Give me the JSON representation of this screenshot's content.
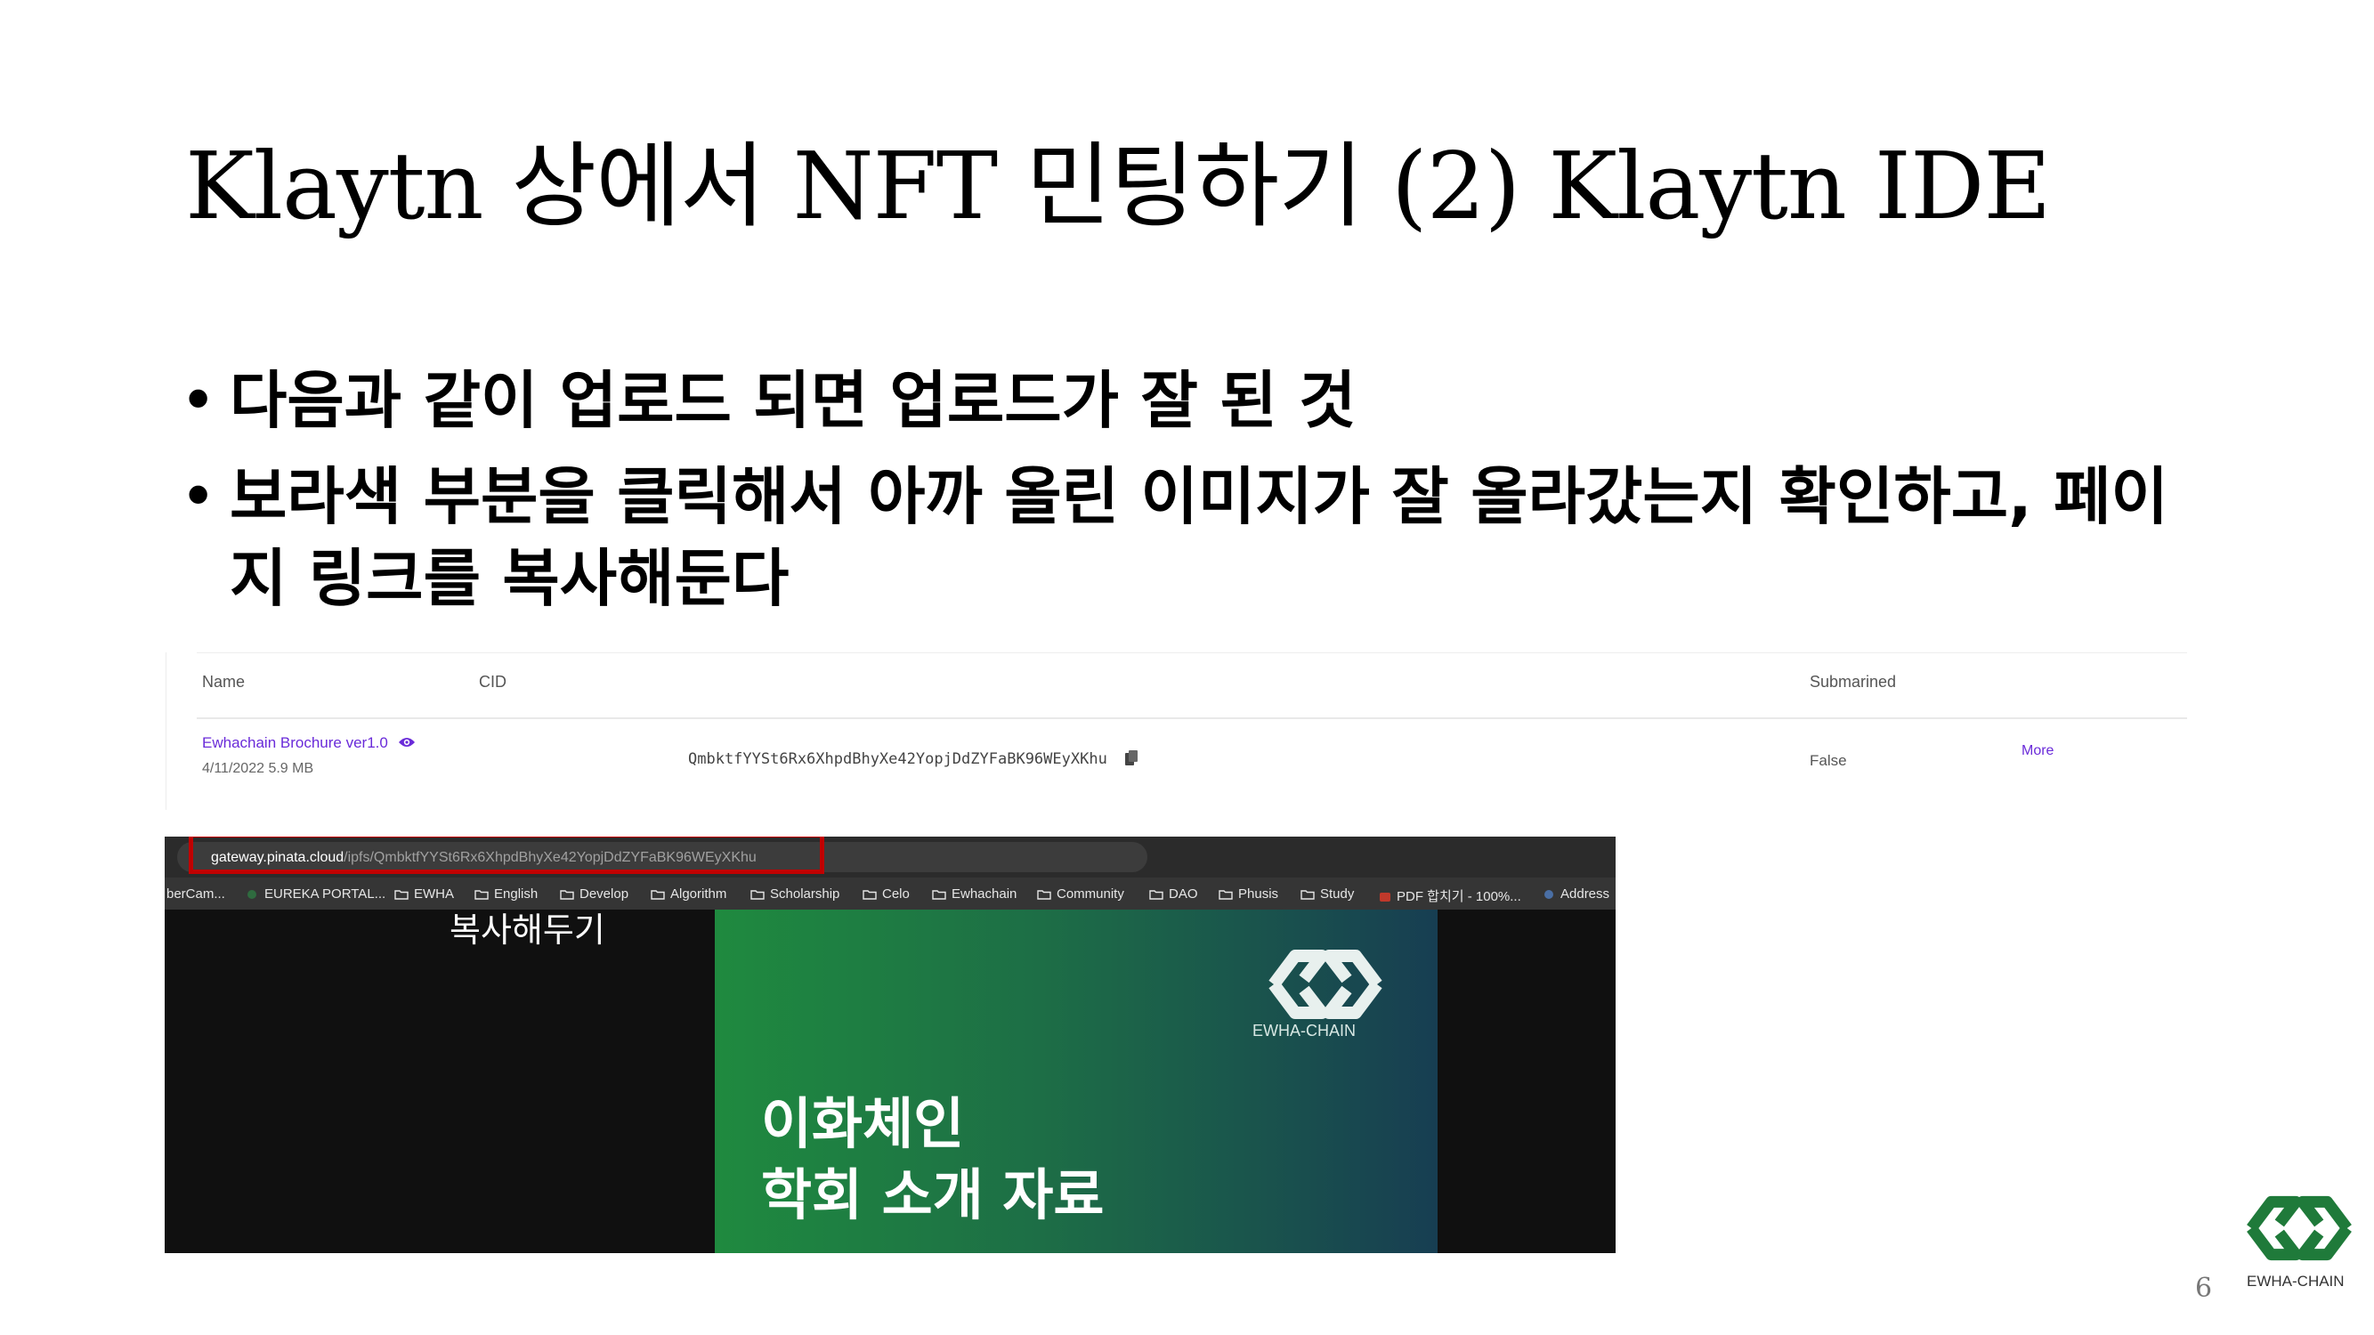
{
  "slide": {
    "title": "Klaytn 상에서 NFT 민팅하기 (2) Klaytn IDE",
    "bullets": [
      "다음과 같이 업로드 되면 업로드가 잘 된 것",
      "보라색 부분을 클릭해서 아까 올린 이미지가 잘 올라갔는지 확인하고, 페이지 링크를 복사해둔다"
    ],
    "bullet_glyph": "•",
    "page_number": "6"
  },
  "pinata_table": {
    "columns": [
      "Name",
      "CID",
      "Submarined"
    ],
    "row": {
      "name": "Ewhachain Brochure ver1.0",
      "meta": "4/11/2022 5.9 MB",
      "cid": "QmbktfYYSt6Rx6XhpdBhyXe42YopjDdZYFaBK96WEyXKhu",
      "submarined": "False",
      "more": "More"
    },
    "accent_color": "#6a2bd9"
  },
  "browser": {
    "url_host": "gateway.pinata.cloud",
    "url_path": "/ipfs/QmbktfYYSt6Rx6XhpdBhyXe42YopjDdZYFaBK96WEyXKhu",
    "highlight_color": "#c00000",
    "bookmarks": [
      "berCam...",
      "EUREKA PORTAL...",
      "EWHA",
      "English",
      "Develop",
      "Algorithm",
      "Scholarship",
      "Celo",
      "Ewhachain",
      "Community",
      "DAO",
      "Phusis",
      "Study",
      "PDF 합치기 - 100%...",
      "Address"
    ],
    "caption": "복사해두기",
    "brochure": {
      "logo_text": "EWHA-CHAIN",
      "line1": "이화체인",
      "line2": "학회 소개 자료"
    }
  },
  "footer_logo": {
    "text": "EWHA-CHAIN",
    "color": "#1f7a3a"
  }
}
